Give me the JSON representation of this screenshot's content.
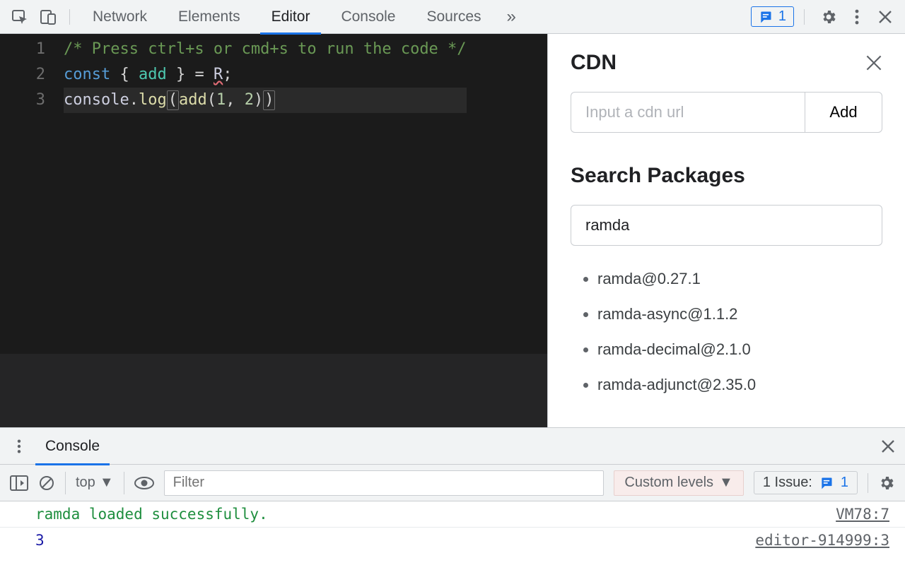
{
  "topbar": {
    "tabs": [
      "Network",
      "Elements",
      "Editor",
      "Console",
      "Sources"
    ],
    "active_tab": "Editor",
    "more_label": "»",
    "issue_count": "1"
  },
  "editor": {
    "line_numbers": [
      "1",
      "2",
      "3"
    ],
    "code": {
      "l1_comment": "/* Press ctrl+s or cmd+s to run the code */",
      "l2_kw": "const",
      "l2_open": " { ",
      "l2_name": "add",
      "l2_close": " } ",
      "l2_eq": "= ",
      "l2_R": "R",
      "l2_semi": ";",
      "l3_obj": "console",
      "l3_dot": ".",
      "l3_log": "log",
      "l3_po": "(",
      "l3_add": "add",
      "l3_po2": "(",
      "l3_n1": "1",
      "l3_comma": ", ",
      "l3_n2": "2",
      "l3_pc2": ")",
      "l3_pc": ")"
    }
  },
  "sidebar": {
    "cdn_heading": "CDN",
    "cdn_placeholder": "Input a cdn url",
    "cdn_add_label": "Add",
    "search_heading": "Search Packages",
    "search_value": "ramda",
    "results": [
      "ramda@0.27.1",
      "ramda-async@1.1.2",
      "ramda-decimal@2.1.0",
      "ramda-adjunct@2.35.0"
    ]
  },
  "drawer": {
    "tab": "Console",
    "context_label": "top",
    "filter_placeholder": "Filter",
    "levels_label": "Custom levels",
    "issues_label": "1 Issue:",
    "issues_count": "1",
    "rows": [
      {
        "kind": "info",
        "msg": "ramda loaded successfully.",
        "src": "VM78:7"
      },
      {
        "kind": "num",
        "msg": "3",
        "src": "editor-914999:3"
      }
    ]
  }
}
